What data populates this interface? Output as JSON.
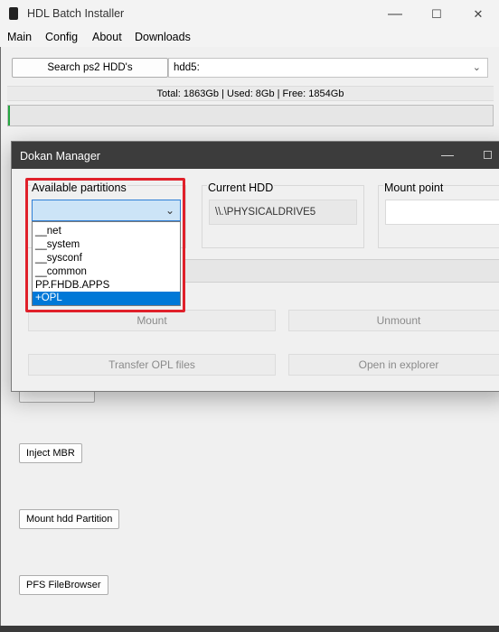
{
  "window": {
    "title": "HDL Batch Installer",
    "caption_minimize": "—",
    "caption_maximize": "☐",
    "caption_close": "✕"
  },
  "menu": [
    "Main",
    "Config",
    "About",
    "Downloads"
  ],
  "toolbar": {
    "search_button": "Search ps2 HDD's",
    "hdd_value": "hdd5:"
  },
  "status": {
    "text": "Total: 1863Gb | Used: 8Gb | Free: 1854Gb",
    "progress_fraction": 0.004,
    "progress_color": "#26a641"
  },
  "side_buttons": [
    "Inject MBR",
    "Mount hdd Partition",
    "PFS FileBrowser"
  ],
  "dokan": {
    "title": "Dokan Manager",
    "available_label": "Available partitions",
    "current_hdd_label": "Current HDD",
    "current_hdd_value": "\\\\.\\PHYSICALDRIVE5",
    "mount_point_label": "Mount point",
    "partitions": [
      "__net",
      "__system",
      "__sysconf",
      "__common",
      "PP.FHDB.APPS",
      "+OPL"
    ],
    "selected_partition": "+OPL",
    "buttons": {
      "mount": "Mount",
      "unmount": "Unmount",
      "transfer": "Transfer OPL files",
      "explorer": "Open in explorer"
    }
  },
  "colors": {
    "highlight": "#e0202a",
    "selection": "#0078d7",
    "dialog_title_bg": "#3c3c3c"
  }
}
